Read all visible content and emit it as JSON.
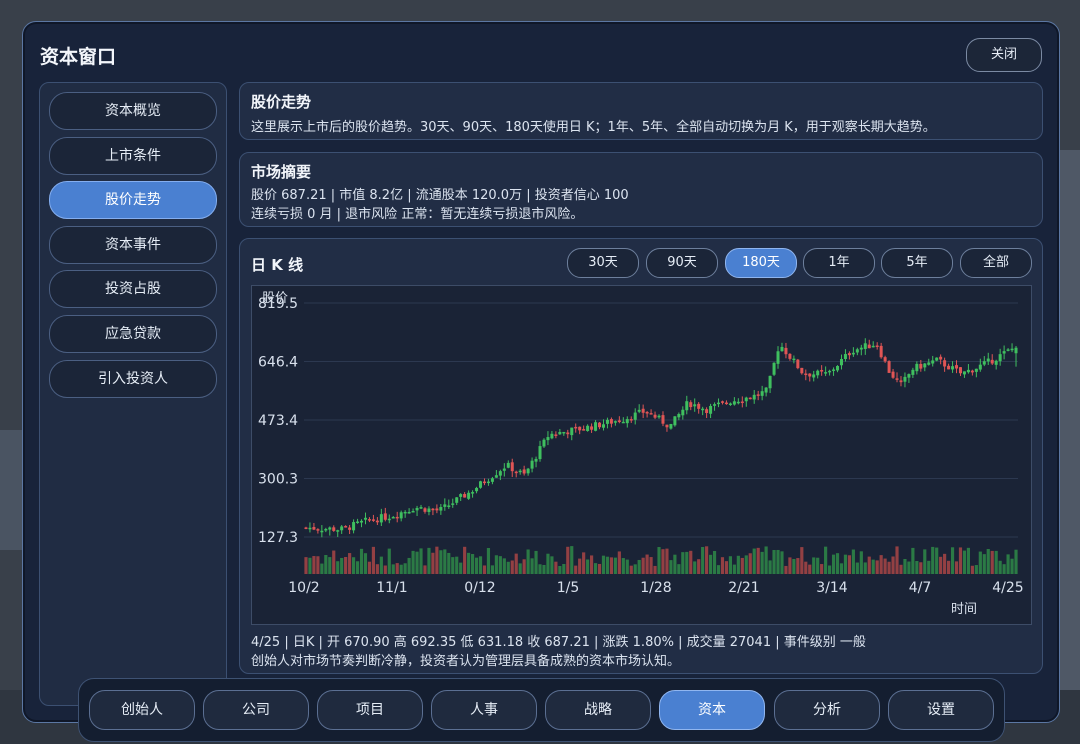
{
  "window": {
    "title": "资本窗口",
    "close_label": "关闭"
  },
  "sidebar": {
    "items": [
      {
        "label": "资本概览"
      },
      {
        "label": "上市条件"
      },
      {
        "label": "股价走势",
        "active": true
      },
      {
        "label": "资本事件"
      },
      {
        "label": "投资占股"
      },
      {
        "label": "应急贷款"
      },
      {
        "label": "引入投资人"
      }
    ]
  },
  "intro": {
    "title": "股价走势",
    "text": "这里展示上市后的股价趋势。30天、90天、180天使用日 K；1年、5年、全部自动切换为月 K，用于观察长期大趋势。"
  },
  "summary": {
    "title": "市场摘要",
    "line1": "股价 687.21 | 市值 8.2亿 | 流通股本 120.0万 | 投资者信心 100",
    "line2": "连续亏损 0 月 | 退市风险 正常：暂无连续亏损退市风险。"
  },
  "chart_panel": {
    "title": "日 K 线",
    "ranges": [
      "30天",
      "90天",
      "180天",
      "1年",
      "5年",
      "全部"
    ],
    "active_range": "180天",
    "info_line1": "4/25 | 日K | 开 670.90 高 692.35 低 631.18 收 687.21 | 涨跌 1.80% | 成交量 27041 | 事件级别 一般",
    "info_line2": "创始人对市场节奏判断冷静，投资者认为管理层具备成熟的资本市场认知。"
  },
  "chart_data": {
    "type": "candlestick",
    "ylabel": "股价",
    "xlabel": "时间",
    "ylim": [
      127.3,
      819.5
    ],
    "y_ticks": [
      "819.5",
      "646.4",
      "473.4",
      "300.3",
      "127.3"
    ],
    "x_ticks": [
      "10/2",
      "11/1",
      "0/12",
      "1/5",
      "1/28",
      "2/21",
      "3/14",
      "4/7",
      "4/25"
    ],
    "close_path": [
      [
        0,
        155
      ],
      [
        6,
        150
      ],
      [
        10,
        175
      ],
      [
        14,
        190
      ],
      [
        18,
        215
      ],
      [
        22,
        205
      ],
      [
        27,
        260
      ],
      [
        33,
        340
      ],
      [
        36,
        310
      ],
      [
        40,
        430
      ],
      [
        46,
        450
      ],
      [
        52,
        475
      ],
      [
        56,
        500
      ],
      [
        60,
        455
      ],
      [
        63,
        525
      ],
      [
        66,
        505
      ],
      [
        70,
        530
      ],
      [
        74,
        545
      ],
      [
        76,
        560
      ],
      [
        78,
        700
      ],
      [
        82,
        610
      ],
      [
        86,
        610
      ],
      [
        90,
        680
      ],
      [
        94,
        700
      ],
      [
        96,
        620
      ],
      [
        98,
        575
      ],
      [
        100,
        625
      ],
      [
        104,
        650
      ],
      [
        108,
        610
      ],
      [
        112,
        640
      ],
      [
        117,
        690
      ]
    ],
    "last_candle": {
      "open": 670.9,
      "high": 692.35,
      "low": 631.18,
      "close": 687.21,
      "volume": 27041
    },
    "up_color": "#3fbf5f",
    "down_color": "#e05555"
  },
  "bottom_nav": {
    "items": [
      "创始人",
      "公司",
      "项目",
      "人事",
      "战略",
      "资本",
      "分析",
      "设置"
    ],
    "active": "资本"
  }
}
